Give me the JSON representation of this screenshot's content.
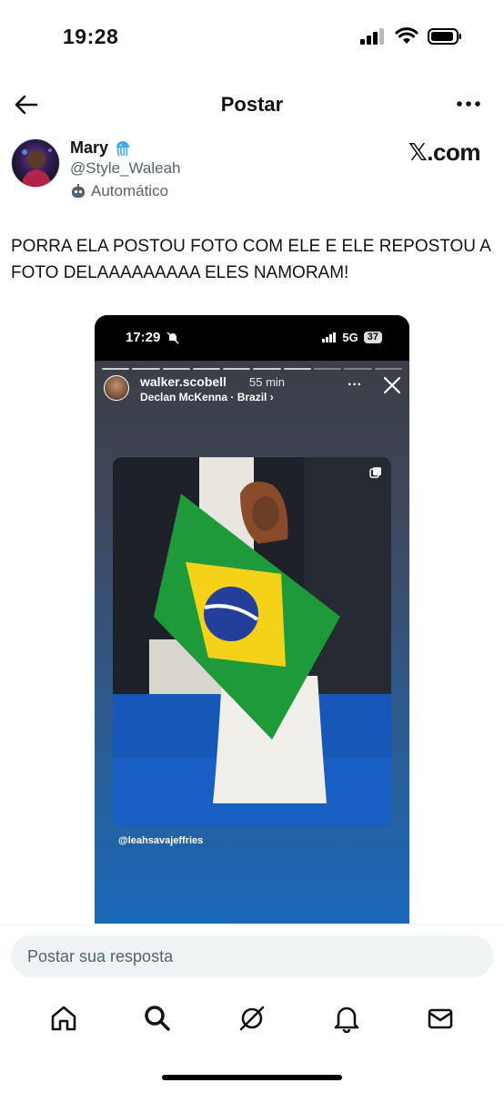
{
  "status_bar": {
    "time": "19:28"
  },
  "header": {
    "title": "Postar"
  },
  "author": {
    "name": "Mary",
    "handle": "@Style_Waleah",
    "automated_label": "Automático",
    "source_logo": "𝕏.com"
  },
  "tweet": {
    "text": "PORRA ELA POSTOU FOTO COM ELE E ELE REPOSTOU A FOTO DELAAAAAAAAA ELES NAMORAM!"
  },
  "media": {
    "phone_time": "17:29",
    "network": "5G",
    "battery": "37",
    "story_user": "walker.scobell",
    "story_time": "55 min",
    "story_music": "Declan McKenna · Brazil ›",
    "mention": "@leahsavajeffries"
  },
  "reply": {
    "placeholder": "Postar sua resposta"
  },
  "colors": {
    "text": "#0f1419",
    "secondary": "#536471",
    "reply_bg": "#eff3f4"
  }
}
